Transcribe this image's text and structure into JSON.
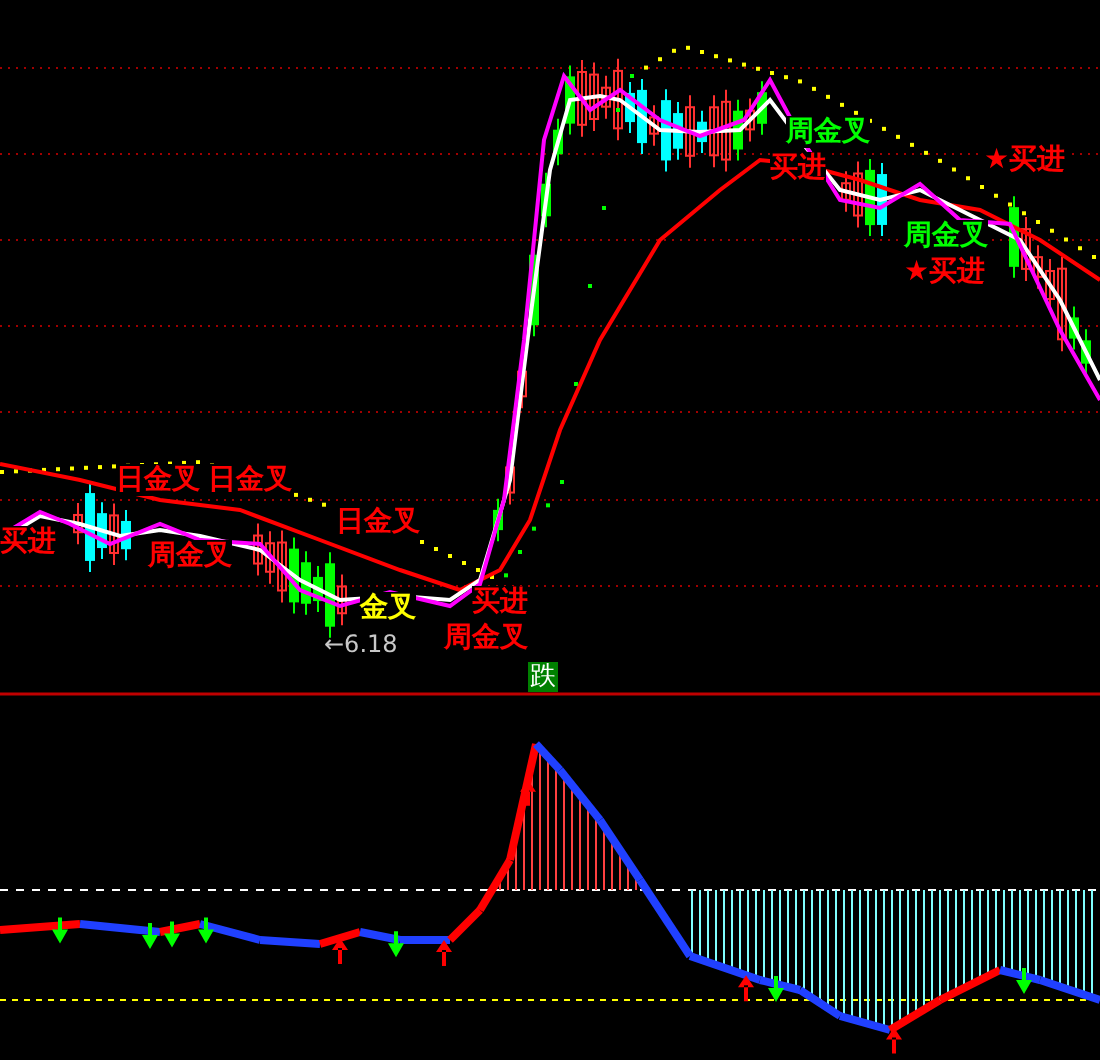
{
  "main_panel": {
    "signals": [
      {
        "text": "日金叉",
        "color": "#ff0000"
      },
      {
        "text": "日金叉",
        "color": "#ff0000"
      },
      {
        "text": "买进",
        "color": "#ff0000"
      },
      {
        "text": "周金叉",
        "color": "#ff0000"
      },
      {
        "text": "日金叉",
        "color": "#ff0000"
      },
      {
        "text": "金叉",
        "color": "#ffff00"
      },
      {
        "text": "买进",
        "color": "#ff0000"
      },
      {
        "text": "周金叉",
        "color": "#ff0000"
      },
      {
        "text": "周金叉",
        "color": "#00ff00"
      },
      {
        "text": "买进",
        "color": "#ff0000"
      },
      {
        "text": "★买进",
        "color": "#ff0000"
      },
      {
        "text": "周金叉",
        "color": "#00ff00"
      },
      {
        "text": "★买进",
        "color": "#ff0000"
      }
    ],
    "price_marker": "←6.18",
    "badge": "跌"
  }
}
